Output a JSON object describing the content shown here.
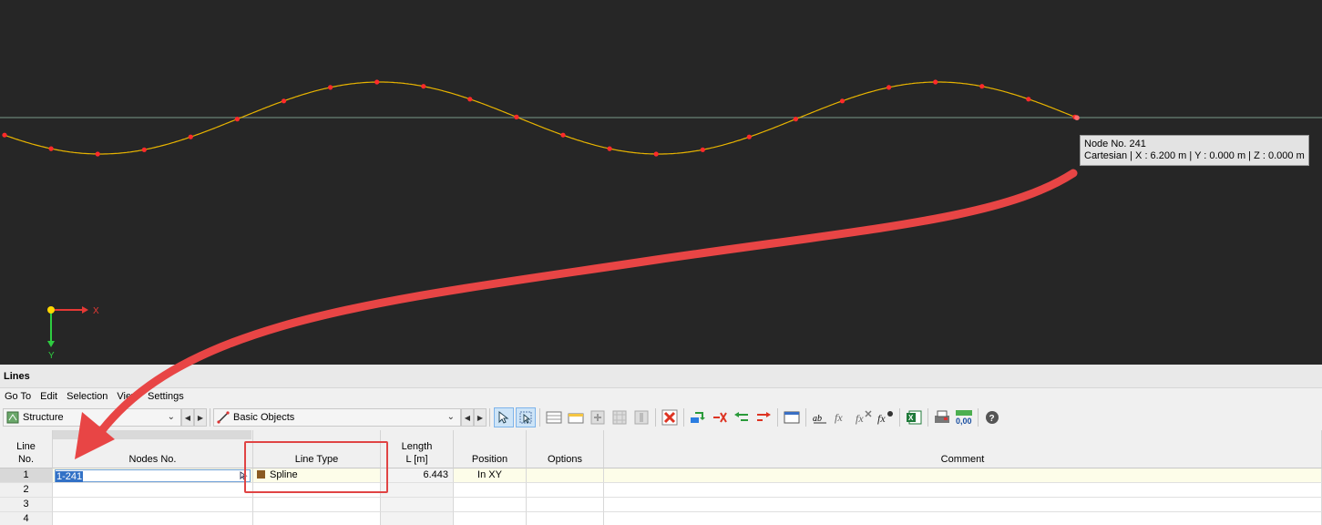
{
  "tooltip": {
    "line1": "Node No. 241",
    "line2": "Cartesian | X : 6.200 m | Y : 0.000 m | Z : 0.000 m"
  },
  "axes": {
    "x_label": "X",
    "y_label": "Y"
  },
  "panel": {
    "title": "Lines",
    "menu": [
      "Go To",
      "Edit",
      "Selection",
      "View",
      "Settings"
    ],
    "combo_structure": "Structure",
    "combo_objects": "Basic Objects"
  },
  "table": {
    "headers": {
      "line_no_1": "Line",
      "line_no_2": "No.",
      "nodes": "Nodes No.",
      "line_type": "Line Type",
      "length_1": "Length",
      "length_2": "L [m]",
      "position": "Position",
      "options": "Options",
      "comment": "Comment"
    },
    "rows": [
      {
        "no": "1",
        "nodes": "1-241",
        "line_type": "Spline",
        "length": "6.443",
        "position": "In XY",
        "options": "",
        "comment": ""
      },
      {
        "no": "2",
        "nodes": "",
        "line_type": "",
        "length": "",
        "position": "",
        "options": "",
        "comment": ""
      },
      {
        "no": "3",
        "nodes": "",
        "line_type": "",
        "length": "",
        "position": "",
        "options": "",
        "comment": ""
      },
      {
        "no": "4",
        "nodes": "",
        "line_type": "",
        "length": "",
        "position": "",
        "options": "",
        "comment": ""
      }
    ]
  },
  "colors": {
    "viewport_bg": "#262626",
    "curve": "#e8b400",
    "node": "#ff2a2a",
    "annotation": "#e04444"
  }
}
